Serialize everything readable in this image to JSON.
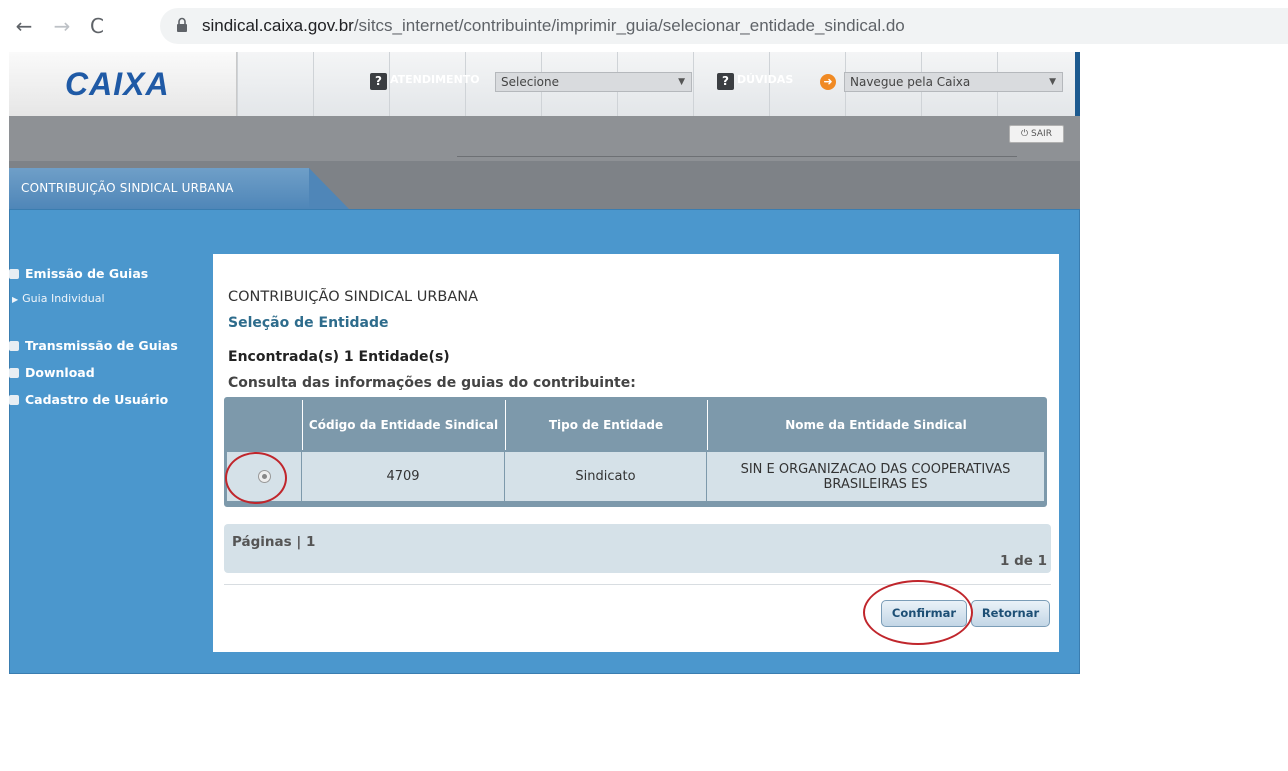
{
  "browser": {
    "back": "←",
    "forward": "→",
    "reload": "C",
    "url_host": "sindical.caixa.gov.br",
    "url_path": "/sitcs_internet/contribuinte/imprimir_guia/selecionar_entidade_sindical.do"
  },
  "header": {
    "logo": "CAIXA",
    "atendimento_label": "ATENDIMENTO",
    "atendimento_select": "Selecione",
    "duvidas_label": "DÚVIDAS",
    "navegue_select": "Navegue pela Caixa",
    "help_icon_glyph": "?"
  },
  "tab": {
    "label_pre": "CONTRIBUIÇÃO SINDICAL URBANA",
    "sair": "SAIR"
  },
  "sidebar": {
    "items": [
      {
        "label": "Emissão de Guias"
      },
      {
        "label": "Guia Individual"
      },
      {
        "label": "Transmissão de Guias"
      },
      {
        "label": "Download"
      },
      {
        "label": "Cadastro de Usuário"
      }
    ]
  },
  "main": {
    "heading": "CONTRIBUIÇÃO SINDICAL URBANA",
    "subtitle": "Seleção de Entidade",
    "found": "Encontrada(s) 1 Entidade(s)",
    "consult": "Consulta das informações de guias do contribuinte:",
    "table": {
      "headers": [
        "Código da Entidade Sindical",
        "Tipo de Entidade",
        "Nome da Entidade Sindical"
      ],
      "row": {
        "codigo": "4709",
        "tipo": "Sindicato",
        "nome": "SIN E ORGANIZACAO DAS COOPERATIVAS BRASILEIRAS ES"
      }
    },
    "pager": {
      "label": "Páginas | 1",
      "count": "1 de 1"
    },
    "buttons": {
      "confirm": "Confirmar",
      "back": "Retornar"
    }
  },
  "colors": {
    "accent": "#4b97cd",
    "table_header": "#7d99ab",
    "annotation_circle": "#c0262c"
  }
}
